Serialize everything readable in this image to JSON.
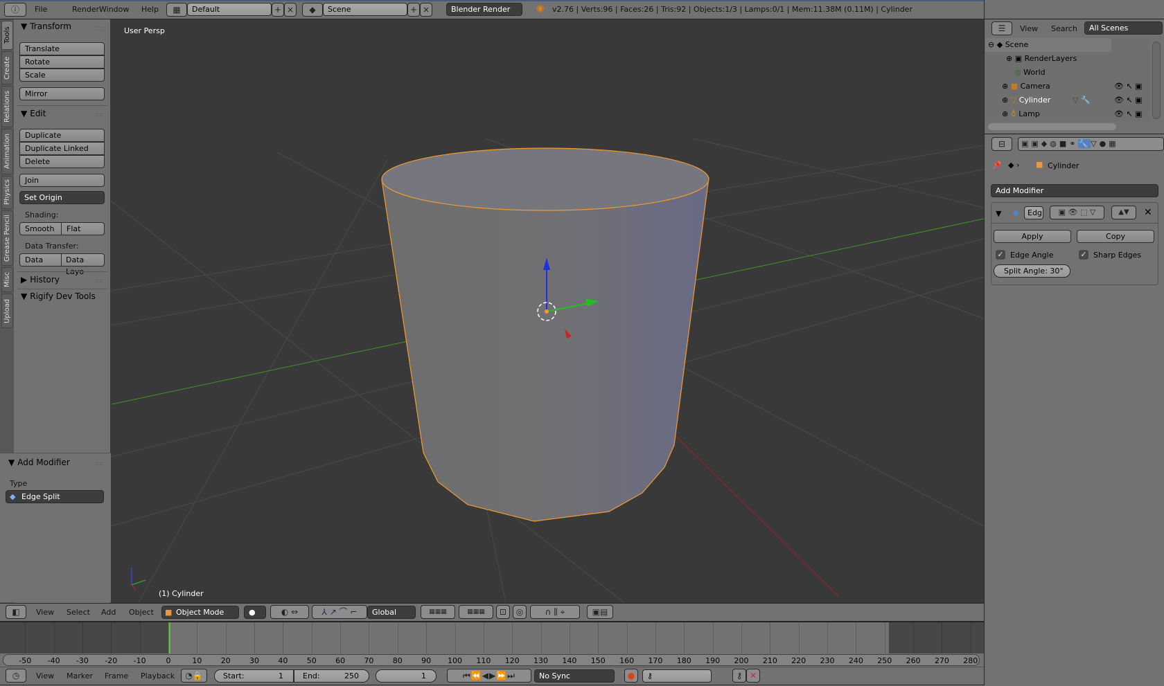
{
  "topbar": {
    "menus": [
      "File",
      "Render",
      "Window",
      "Help"
    ],
    "layout": "Default",
    "scene": "Scene",
    "engine": "Blender Render",
    "info": "v2.76 | Verts:96 | Faces:26 | Tris:92 | Objects:1/3 | Lamps:0/1 | Mem:11.38M (0.11M) | Cylinder"
  },
  "toolshelf": {
    "tabs": [
      "Tools",
      "Create",
      "Relations",
      "Animation",
      "Physics",
      "Grease Pencil",
      "Misc",
      "Upload"
    ],
    "transform": {
      "title": "Transform",
      "buttons": [
        "Translate",
        "Rotate",
        "Scale",
        "Mirror"
      ]
    },
    "edit": {
      "title": "Edit",
      "buttons": [
        "Duplicate",
        "Duplicate Linked",
        "Delete",
        "Join"
      ],
      "set_origin": "Set Origin",
      "shading_label": "Shading:",
      "smooth": "Smooth",
      "flat": "Flat",
      "data_transfer_label": "Data Transfer:",
      "data": "Data",
      "data_layout": "Data Layo"
    },
    "history": "History",
    "rigify": "Rigify Dev Tools",
    "operator": {
      "title": "Add Modifier",
      "type_label": "Type",
      "type_value": "Edge Split"
    }
  },
  "viewport": {
    "label": "User Persp",
    "object_label": "(1) Cylinder",
    "header": {
      "menus": [
        "View",
        "Select",
        "Add",
        "Object"
      ],
      "mode": "Object Mode",
      "orientation": "Global"
    },
    "colors": {
      "background": "#393939",
      "selection": "#f29a2e",
      "x_axis": "#c02020",
      "y_axis": "#3a9a20"
    }
  },
  "timeline": {
    "ticks": [
      "-50",
      "-40",
      "-30",
      "-20",
      "-10",
      "0",
      "10",
      "20",
      "30",
      "40",
      "50",
      "60",
      "70",
      "80",
      "90",
      "100",
      "110",
      "120",
      "130",
      "140",
      "150",
      "160",
      "170",
      "180",
      "190",
      "200",
      "210",
      "220",
      "230",
      "240",
      "250",
      "260",
      "270",
      "280"
    ],
    "current_frame": 1,
    "menus": [
      "View",
      "Marker",
      "Frame",
      "Playback"
    ],
    "start_label": "Start:",
    "start": "1",
    "end_label": "End:",
    "end": "250",
    "frame": "1",
    "sync": "No Sync"
  },
  "outliner": {
    "menus": [
      "View",
      "Search"
    ],
    "filter": "All Scenes",
    "items": [
      "Scene",
      "RenderLayers",
      "World",
      "Camera",
      "Cylinder",
      "Lamp"
    ]
  },
  "properties": {
    "breadcrumb_object": "Cylinder",
    "add_modifier": "Add Modifier",
    "modifier": {
      "name": "Edg",
      "apply": "Apply",
      "copy": "Copy",
      "edge_angle": "Edge Angle",
      "edge_angle_checked": true,
      "sharp_edges": "Sharp Edges",
      "sharp_edges_checked": true,
      "split_angle": "Split Angle: 30°"
    }
  }
}
